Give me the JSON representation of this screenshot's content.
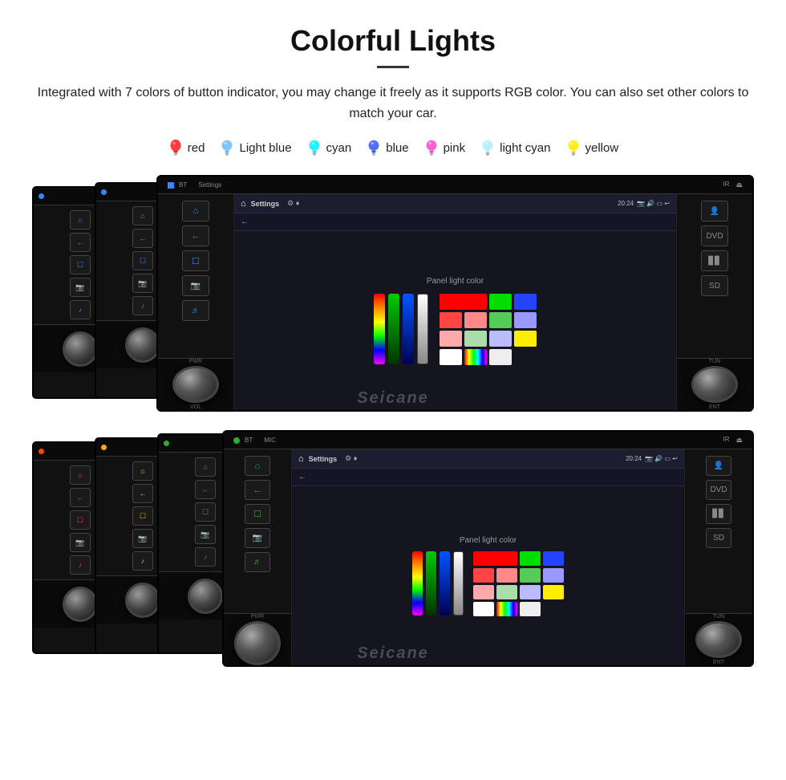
{
  "page": {
    "title": "Colorful Lights",
    "description": "Integrated with 7 colors of button indicator, you may change it freely as it supports RGB color. You can also set other colors to match your car.",
    "watermark": "Seicane"
  },
  "colors": [
    {
      "id": "red",
      "label": "red",
      "color": "#ff2020",
      "bulb_color": "#ff4040"
    },
    {
      "id": "light-blue",
      "label": "Light blue",
      "color": "#66bbff",
      "bulb_color": "#66bbff"
    },
    {
      "id": "cyan",
      "label": "cyan",
      "color": "#00eeff",
      "bulb_color": "#00eeff"
    },
    {
      "id": "blue",
      "label": "blue",
      "color": "#3355ff",
      "bulb_color": "#3355ff"
    },
    {
      "id": "pink",
      "label": "pink",
      "color": "#ff44cc",
      "bulb_color": "#ff44cc"
    },
    {
      "id": "light-cyan",
      "label": "light cyan",
      "color": "#99eeff",
      "bulb_color": "#aaeeff"
    },
    {
      "id": "yellow",
      "label": "yellow",
      "color": "#ffee00",
      "bulb_color": "#ffee00"
    }
  ],
  "screen1": {
    "title": "Settings",
    "time": "20:24",
    "panel_label": "Panel light color",
    "color_grid": [
      "#ff0000",
      "#00cc00",
      "#0000ff",
      "#888888",
      "#ff6666",
      "#66cc66",
      "#6666ff",
      "#aaaaaa",
      "#ffaaaa",
      "#aaddaa",
      "#aaaaff",
      "#cccccc",
      "#ffee00",
      "#ffffff",
      "rainbow",
      "#ffffff"
    ]
  },
  "screen2": {
    "title": "Settings",
    "time": "20:24",
    "panel_label": "Panel light color"
  },
  "buttons_top": {
    "bt_icon": "⌂",
    "back_icon": "←",
    "android_icon": "☰",
    "photo_icon": "📷",
    "media_icon": "♪",
    "home_color_1": "#3388ff",
    "home_color_2": "#ff44cc"
  }
}
